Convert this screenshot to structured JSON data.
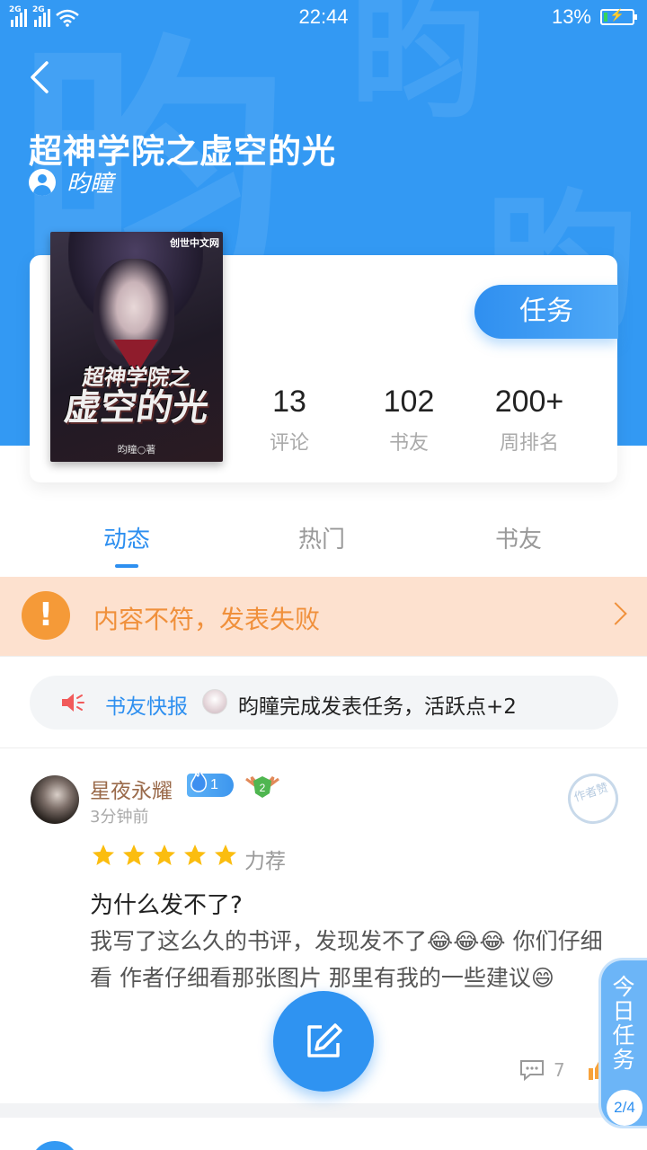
{
  "status_bar": {
    "net1": "2G",
    "net2": "2G",
    "time": "22:44",
    "battery_pct": "13%",
    "battery_level": 0.13
  },
  "header": {
    "title": "超神学院之虚空的光",
    "author": "昀瞳"
  },
  "book": {
    "cover_title_line1": "超神学院之",
    "cover_title_line2": "虚空的光",
    "cover_logo": "创世中文网",
    "cover_author": "昀瞳○著"
  },
  "task_button": "任务",
  "stats": [
    {
      "value": "13",
      "label": "评论"
    },
    {
      "value": "102",
      "label": "书友"
    },
    {
      "value": "200+",
      "label": "周排名"
    }
  ],
  "tabs": [
    {
      "label": "动态",
      "active": true
    },
    {
      "label": "热门",
      "active": false
    },
    {
      "label": "书友",
      "active": false
    }
  ],
  "alert": {
    "icon": "!",
    "text": "内容不符，发表失败"
  },
  "news": {
    "label": "书友快报",
    "text": "昀瞳完成发表任务，活跃点+2"
  },
  "comment": {
    "user": "星夜永耀",
    "fans_level": "1",
    "user_level": "2",
    "time": "3分钟前",
    "stamp": "作者赞",
    "rating": 5,
    "rating_label": "力荐",
    "title": "为什么发不了?",
    "body": "我写了这么久的书评，发现发不了😂😂😂 你们仔细看 作者仔细看那张图片 那里有我的一些建议😄",
    "reply_count": "7"
  },
  "daily_task": {
    "label": "今日任务",
    "progress": "2/4"
  },
  "colors": {
    "primary": "#3399f3",
    "alert_bg": "#fde1cf",
    "alert_fg": "#f0903b",
    "star": "#fbbd0f"
  }
}
